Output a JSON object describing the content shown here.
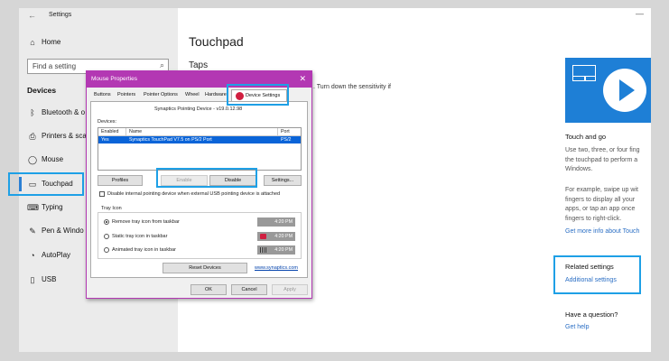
{
  "window": {
    "app_title": "Settings",
    "back_glyph": "←",
    "minimize_glyph": "—"
  },
  "sidebar": {
    "home_label": "Home",
    "search_placeholder": "Find a setting",
    "section_label": "Devices",
    "items": [
      {
        "label": "Bluetooth & o",
        "icon": "bluetooth-icon"
      },
      {
        "label": "Printers & sca",
        "icon": "printer-icon"
      },
      {
        "label": "Mouse",
        "icon": "mouse-icon"
      },
      {
        "label": "Touchpad",
        "icon": "touchpad-icon"
      },
      {
        "label": "Typing",
        "icon": "keyboard-icon"
      },
      {
        "label": "Pen & Windo",
        "icon": "pen-icon"
      },
      {
        "label": "AutoPlay",
        "icon": "autoplay-icon"
      },
      {
        "label": "USB",
        "icon": "usb-icon"
      }
    ]
  },
  "main": {
    "title": "Touchpad",
    "section": "Taps",
    "background_text": ". Turn down the sensitivity if"
  },
  "right_column": {
    "video_title": "Touch and go",
    "video_text": [
      "Use two, three, or four fing",
      "the touchpad to perform a",
      "Windows."
    ],
    "example_text": [
      "For example, swipe up wit",
      "fingers to display all your",
      "apps, or tap an app once",
      "fingers to right-click."
    ],
    "more_info_link": "Get more info about Touch",
    "related_title": "Related settings",
    "additional_link": "Additional settings",
    "question_title": "Have a question?",
    "help_link": "Get help"
  },
  "dialog": {
    "title": "Mouse Properties",
    "close_glyph": "✕",
    "tabs": [
      "Buttons",
      "Pointers",
      "Pointer Options",
      "Wheel",
      "Hardware",
      "Device Settings"
    ],
    "active_tab": "Device Settings",
    "device_name": "Synaptics Pointing Device - v19.0.12.98",
    "devices_label": "Devices:",
    "columns": [
      "Enabled",
      "Name",
      "Port"
    ],
    "device_row": {
      "enabled": "Yes",
      "name": "Synaptics TouchPad V7.5 on PS/2 Port",
      "port": "PS/2"
    },
    "buttons": {
      "profiles": "Profiles",
      "enable": "Enable",
      "disable": "Disable",
      "settings": "Settings..."
    },
    "disable_internal": "Disable internal pointing device when external USB pointing device is attached",
    "tray_icon_label": "Tray Icon",
    "tray_options": [
      {
        "label": "Remove tray icon from taskbar",
        "selected": true,
        "time": "4:20 PM"
      },
      {
        "label": "Static tray icon in taskbar",
        "selected": false,
        "time": "4:20 PM"
      },
      {
        "label": "Animated tray icon in taskbar",
        "selected": false,
        "time": "4:20 PM"
      }
    ],
    "reset_devices": "Reset Devices",
    "link": "www.synaptics.com",
    "ok": "OK",
    "cancel": "Cancel",
    "apply": "Apply"
  },
  "colors": {
    "accent": "#1ea0e6",
    "dialog_border": "#b338b3",
    "selection": "#0a64d8",
    "link": "#2a6ec4"
  }
}
